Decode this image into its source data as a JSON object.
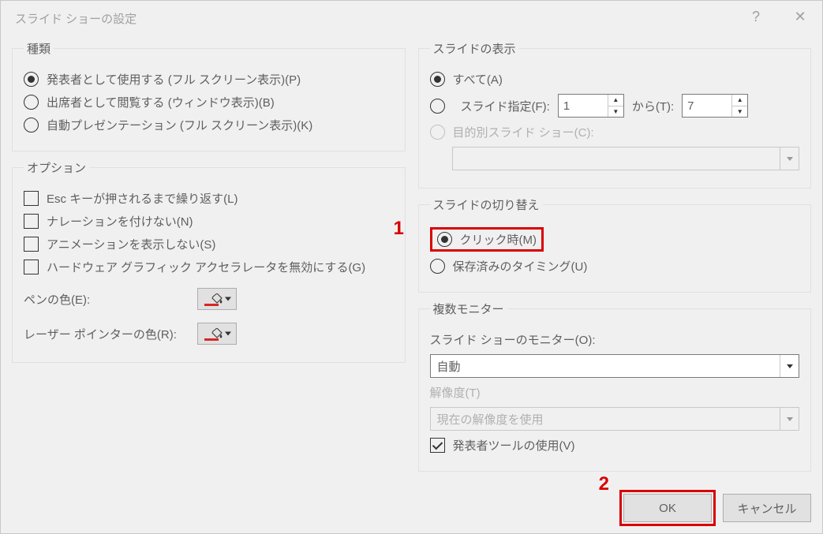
{
  "title": "スライド ショーの設定",
  "annotations": {
    "n1": "1",
    "n2": "2"
  },
  "type_group": {
    "legend": "種類",
    "opt1": "発表者として使用する (フル スクリーン表示)(P)",
    "opt2": "出席者として閲覧する (ウィンドウ表示)(B)",
    "opt3": "自動プレゼンテーション (フル スクリーン表示)(K)"
  },
  "options_group": {
    "legend": "オプション",
    "chk1": "Esc キーが押されるまで繰り返す(L)",
    "chk2": "ナレーションを付けない(N)",
    "chk3": "アニメーションを表示しない(S)",
    "chk4": "ハードウェア グラフィック アクセラレータを無効にする(G)",
    "pen_label": "ペンの色(E):",
    "laser_label": "レーザー ポインターの色(R):"
  },
  "show_slides": {
    "legend": "スライドの表示",
    "all": "すべて(A)",
    "range": "スライド指定(F):",
    "from_val": "1",
    "to_label": "から(T):",
    "to_val": "7",
    "custom": "目的別スライド ショー(C):"
  },
  "advance": {
    "legend": "スライドの切り替え",
    "manual": "クリック時(M)",
    "timings": "保存済みのタイミング(U)"
  },
  "monitors": {
    "legend": "複数モニター",
    "monitor_label": "スライド ショーのモニター(O):",
    "monitor_val": "自動",
    "res_label": "解像度(T)",
    "res_val": "現在の解像度を使用",
    "presenter": "発表者ツールの使用(V)"
  },
  "buttons": {
    "ok": "OK",
    "cancel": "キャンセル"
  }
}
